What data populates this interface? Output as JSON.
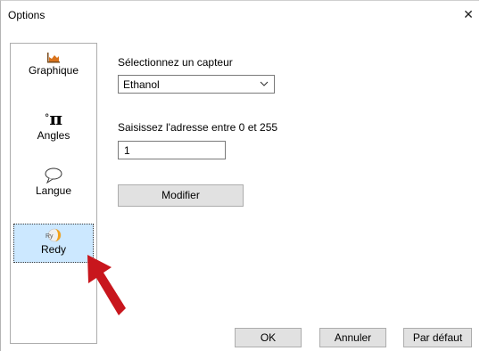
{
  "window": {
    "title": "Options",
    "close_glyph": "✕"
  },
  "sidebar": {
    "items": [
      {
        "label": "Graphique",
        "icon": "area-chart-icon",
        "selected": false
      },
      {
        "label": "Angles",
        "icon": "pi-icon",
        "icon_text": "π",
        "icon_sup": "°",
        "selected": false
      },
      {
        "label": "Langue",
        "icon": "speech-bubble-icon",
        "selected": false
      },
      {
        "label": "Redy",
        "icon": "redy-logo-icon",
        "icon_text": "Ry",
        "selected": true
      }
    ]
  },
  "main": {
    "sensor_label": "Sélectionnez un capteur",
    "sensor_value": "Ethanol",
    "address_label": "Saisissez l'adresse entre 0 et 255",
    "address_value": "1",
    "modify_button": "Modifier"
  },
  "footer": {
    "ok": "OK",
    "cancel": "Annuler",
    "default": "Par défaut"
  },
  "colors": {
    "selected_bg": "#cce8ff",
    "button_bg": "#e1e1e1",
    "arrow": "#c8161d"
  }
}
